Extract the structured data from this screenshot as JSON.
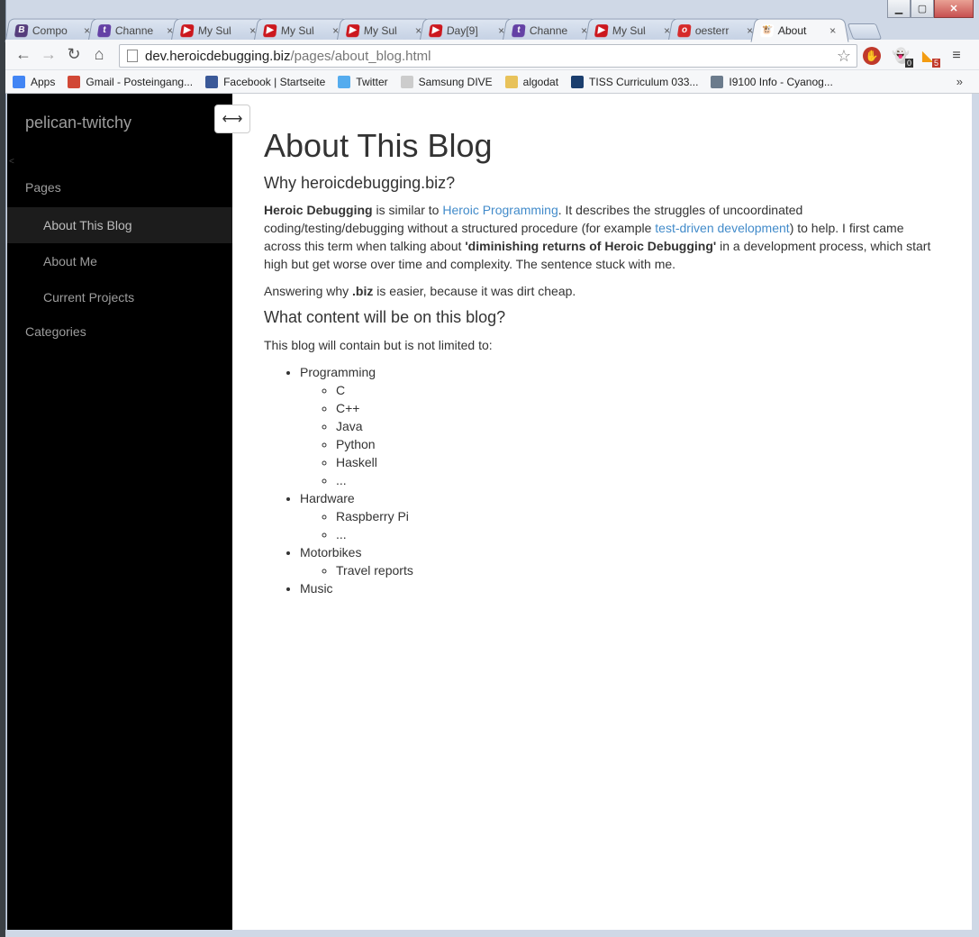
{
  "window": {
    "tabs": [
      {
        "label": "Compo",
        "favicon": "bootstrap-icon",
        "color": "#563d7c",
        "glyph": "B"
      },
      {
        "label": "Channe",
        "favicon": "twitch-icon",
        "color": "#6441a5",
        "glyph": "t"
      },
      {
        "label": "My Sul",
        "favicon": "youtube-icon",
        "color": "#cc181e",
        "glyph": "▶"
      },
      {
        "label": "My Sul",
        "favicon": "youtube-icon",
        "color": "#cc181e",
        "glyph": "▶"
      },
      {
        "label": "My Sul",
        "favicon": "youtube-icon",
        "color": "#cc181e",
        "glyph": "▶"
      },
      {
        "label": "Day[9]",
        "favicon": "youtube-icon",
        "color": "#cc181e",
        "glyph": "▶"
      },
      {
        "label": "Channe",
        "favicon": "twitch-icon",
        "color": "#6441a5",
        "glyph": "t"
      },
      {
        "label": "My Sul",
        "favicon": "youtube-icon",
        "color": "#cc181e",
        "glyph": "▶"
      },
      {
        "label": "oesterr",
        "favicon": "oe-icon",
        "color": "#d62a2a",
        "glyph": "o"
      },
      {
        "label": "About",
        "favicon": "cow-icon",
        "color": "#ffffff",
        "glyph": "🐮",
        "active": true
      }
    ],
    "close_glyph": "×"
  },
  "toolbar": {
    "url_host": "dev.heroicdebugging.biz",
    "url_path": "/pages/about_blog.html",
    "ext_badge_1": "0",
    "ext_badge_2": "5"
  },
  "bookmarks": [
    {
      "label": "Apps",
      "icon": "apps-grid-icon",
      "color": "#4285f4"
    },
    {
      "label": "Gmail - Posteingang...",
      "icon": "gmail-icon",
      "color": "#d14836"
    },
    {
      "label": "Facebook | Startseite",
      "icon": "facebook-icon",
      "color": "#3b5998"
    },
    {
      "label": "Twitter",
      "icon": "twitter-icon",
      "color": "#55acee"
    },
    {
      "label": "Samsung DIVE",
      "icon": "page-icon",
      "color": "#cccccc"
    },
    {
      "label": "algodat",
      "icon": "folder-icon",
      "color": "#e8c25a"
    },
    {
      "label": "TISS Curriculum 033...",
      "icon": "tiss-icon",
      "color": "#1b3e6e"
    },
    {
      "label": "I9100 Info - Cyanog...",
      "icon": "android-icon",
      "color": "#6b7b8c"
    }
  ],
  "sidebar": {
    "brand": "pelican-twitchy",
    "pages_heading": "Pages",
    "items": [
      {
        "label": "About This Blog",
        "active": true
      },
      {
        "label": "About Me"
      },
      {
        "label": "Current Projects"
      }
    ],
    "categories_heading": "Categories",
    "toggle_glyph": "⟷"
  },
  "content": {
    "title": "About This Blog",
    "subtitle": "Why heroicdebugging.biz?",
    "p1": {
      "bold1": "Heroic Debugging",
      "t1": " is similar to ",
      "link1": "Heroic Programming",
      "t2": ". It describes the struggles of uncoordinated coding/testing/debugging without a structured procedure (for example ",
      "link2": "test-driven development",
      "t3": ") to help. I first came across this term when talking about ",
      "bold2": "'diminishing returns of Heroic Debugging'",
      "t4": " in a development process, which start high but get worse over time and complexity. The sentence stuck with me."
    },
    "p2": {
      "t1": "Answering why ",
      "bold": ".biz",
      "t2": " is easier, because it was dirt cheap."
    },
    "heading2": "What content will be on this blog?",
    "p3": "This blog will contain but is not limited to:",
    "list": [
      {
        "label": "Programming",
        "children": [
          "C",
          "C++",
          "Java",
          "Python",
          "Haskell",
          "..."
        ]
      },
      {
        "label": "Hardware",
        "children": [
          "Raspberry Pi",
          "..."
        ]
      },
      {
        "label": "Motorbikes",
        "children": [
          "Travel reports"
        ]
      },
      {
        "label": "Music",
        "children": []
      }
    ]
  }
}
